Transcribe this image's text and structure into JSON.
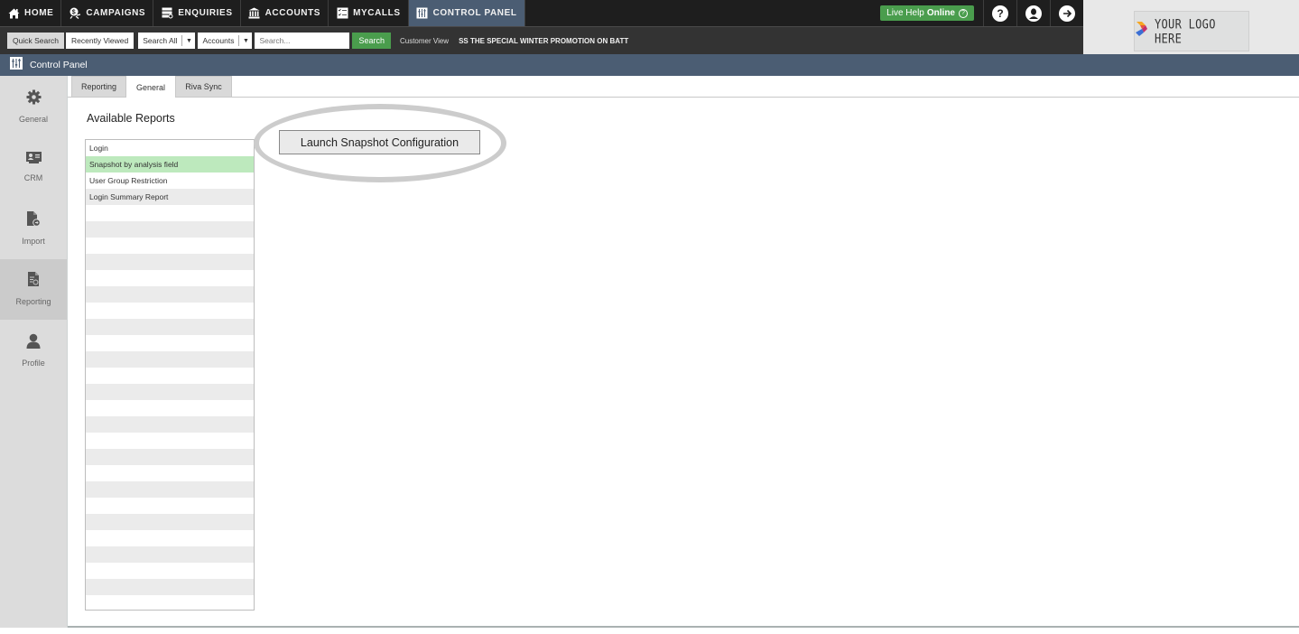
{
  "nav": {
    "items": [
      {
        "label": "HOME",
        "icon": "home-icon"
      },
      {
        "label": "CAMPAIGNS",
        "icon": "campaigns-icon"
      },
      {
        "label": "ENQUIRIES",
        "icon": "enquiries-icon"
      },
      {
        "label": "ACCOUNTS",
        "icon": "bank-icon"
      },
      {
        "label": "MYCALLS",
        "icon": "checklist-icon"
      },
      {
        "label": "CONTROL PANEL",
        "icon": "control-panel-icon",
        "active": true
      }
    ],
    "live_help": {
      "prefix": "Live Help",
      "status": "Online",
      "icon": "?"
    },
    "help_icon": "?",
    "colors": {
      "bar": "#1e1e1e",
      "active": "#4b5d73",
      "live_help": "#4a9d4d"
    }
  },
  "searchbar": {
    "quick_search": "Quick Search",
    "recently_viewed": "Recently Viewed",
    "scope_select": "Search All",
    "entity_select": "Accounts",
    "search_placeholder": "Search...",
    "search_button": "Search",
    "customer_view": "Customer View",
    "ticker": "SS THE SPECIAL WINTER PROMOTION ON BATT"
  },
  "logo": {
    "text": "YOUR LOGO HERE"
  },
  "section": {
    "title": "Control Panel"
  },
  "sidebar": {
    "items": [
      {
        "label": "General",
        "icon": "gear-icon"
      },
      {
        "label": "CRM",
        "icon": "crm-card-icon"
      },
      {
        "label": "Import",
        "icon": "import-file-icon"
      },
      {
        "label": "Reporting",
        "icon": "report-icon",
        "active": true
      },
      {
        "label": "Profile",
        "icon": "user-icon"
      }
    ]
  },
  "tabs": [
    {
      "label": "Reporting"
    },
    {
      "label": "General",
      "active": true
    },
    {
      "label": "Riva Sync"
    }
  ],
  "reports": {
    "title": "Available Reports",
    "items": [
      "Login",
      "Snapshot by analysis field",
      "User Group Restriction",
      "Login Summary Report"
    ],
    "selected_index": 1,
    "selected_color": "#bde9bd"
  },
  "launch_button": "Launch Snapshot Configuration"
}
